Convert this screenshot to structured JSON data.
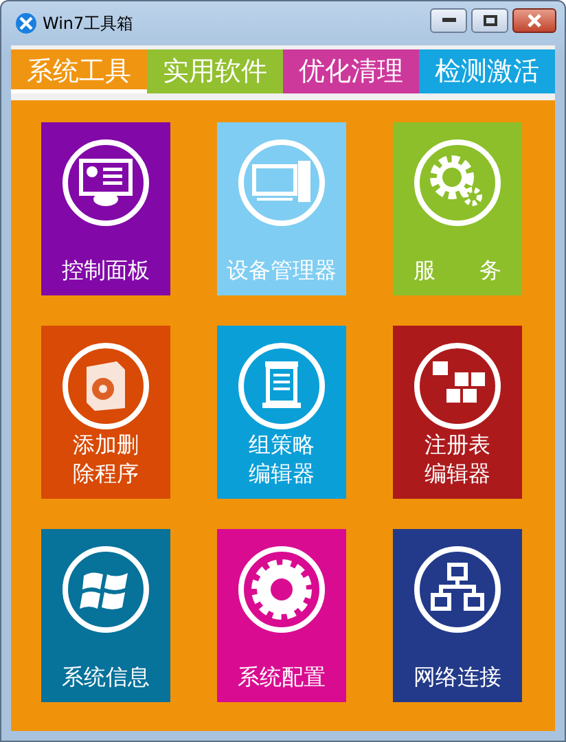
{
  "window": {
    "title": "Win7工具箱"
  },
  "tabs": [
    {
      "label": "系统工具",
      "color": "#f0930a",
      "selected": true
    },
    {
      "label": "实用软件",
      "color": "#8fbf2a",
      "selected": false
    },
    {
      "label": "优化清理",
      "color": "#cc3399",
      "selected": false
    },
    {
      "label": "检测激活",
      "color": "#0ea3e0",
      "selected": false
    }
  ],
  "tiles": [
    {
      "kind": "control-panel",
      "lines": [
        "控制面板"
      ],
      "color": "#8208a8"
    },
    {
      "kind": "computer",
      "lines": [
        "设备管理器"
      ],
      "color": "#7fcdf2"
    },
    {
      "kind": "gears",
      "lines": [
        "服　　务"
      ],
      "color": "#8cbf2a"
    },
    {
      "kind": "software-box",
      "lines": [
        "添加删",
        "除程序"
      ],
      "color": "#d84a05"
    },
    {
      "kind": "scroll",
      "lines": [
        "组策略",
        "编辑器"
      ],
      "color": "#0b9fd8"
    },
    {
      "kind": "cubes",
      "lines": [
        "注册表",
        "编辑器"
      ],
      "color": "#ad1a1c"
    },
    {
      "kind": "windows",
      "lines": [
        "系统信息"
      ],
      "color": "#07729a"
    },
    {
      "kind": "gear",
      "lines": [
        "系统配置"
      ],
      "color": "#d90c91"
    },
    {
      "kind": "network",
      "lines": [
        "网络连接"
      ],
      "color": "#233a8a"
    }
  ]
}
